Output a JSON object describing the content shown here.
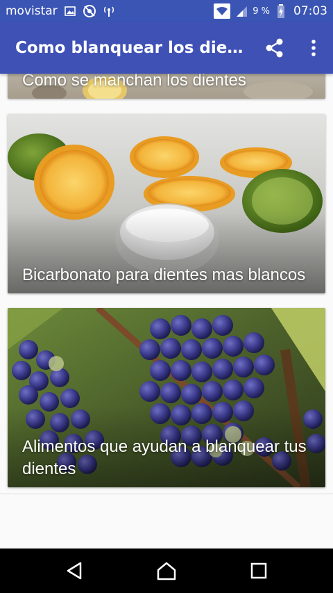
{
  "status_bar": {
    "carrier": "movistar",
    "battery_percent": "9 %",
    "time": "07:03",
    "icons": [
      "image-icon",
      "sync-disabled-icon",
      "hotspot-icon",
      "wifi-icon",
      "signal-icon",
      "battery-charging-icon"
    ]
  },
  "app_bar": {
    "title": "Como blanquear los dient...",
    "share_icon": "share-icon",
    "menu_icon": "more-vert-icon",
    "color": "#3f51b5"
  },
  "cards": [
    {
      "title": "Como se manchan los dientes",
      "image": "lemon-slices-image"
    },
    {
      "title": "Bicarbonato para dientes mas blancos",
      "image": "lemons-and-baking-soda-image"
    },
    {
      "title": "Alimentos que ayudan a blanquear tus dientes",
      "image": "purple-grapes-image"
    }
  ],
  "nav_bar": {
    "back_icon": "back-icon",
    "home_icon": "home-icon",
    "recents_icon": "recents-icon"
  }
}
